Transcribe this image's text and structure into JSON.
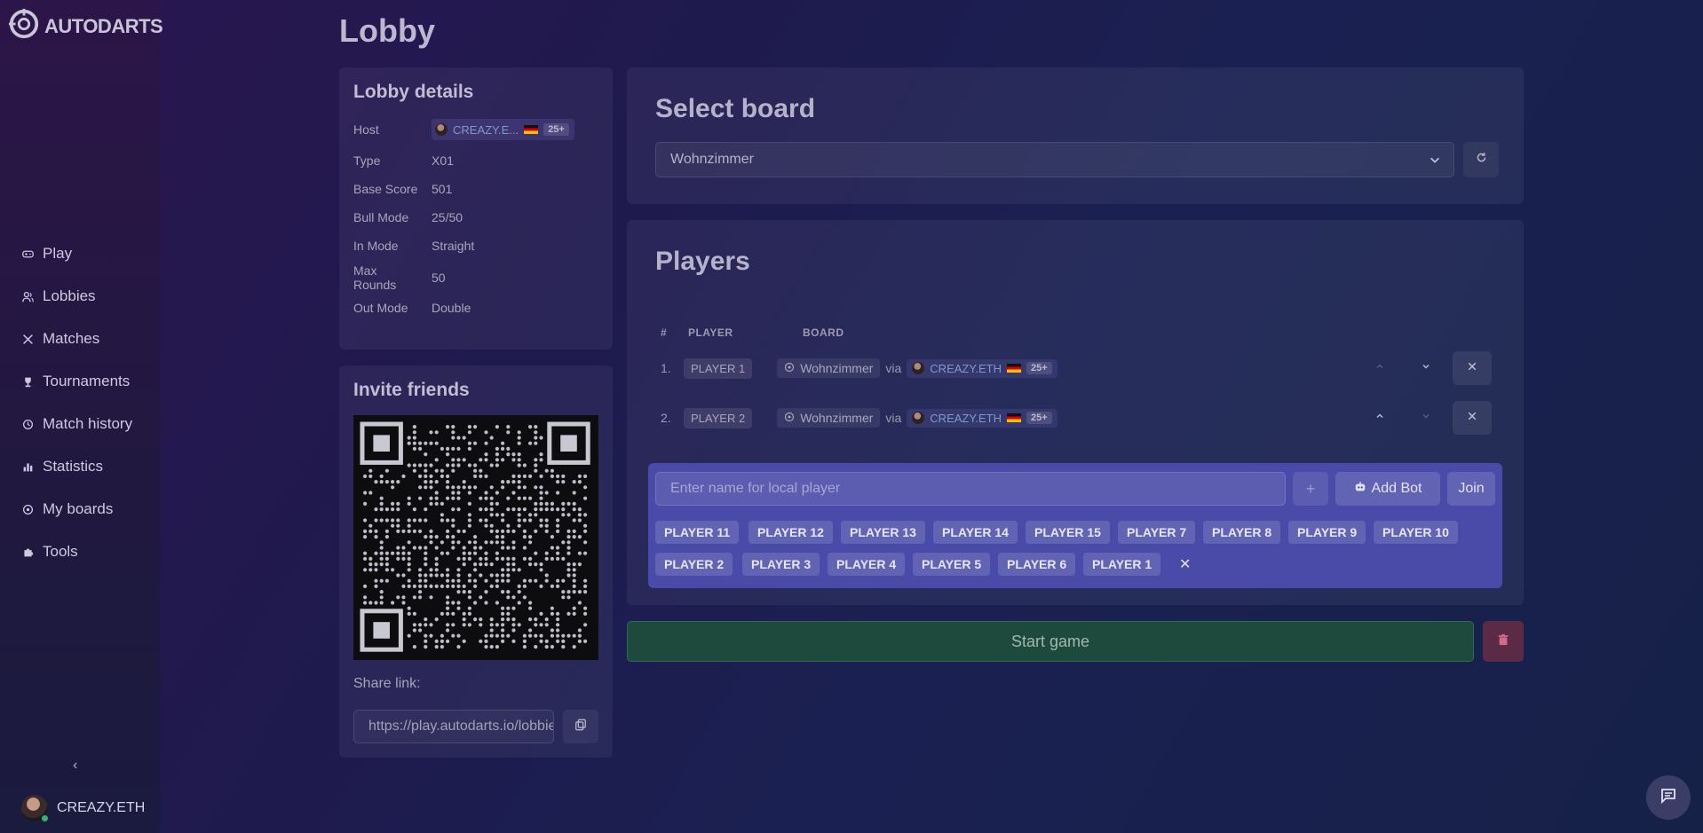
{
  "app": {
    "logo_text": "AUTODARTS"
  },
  "page": {
    "title": "Lobby"
  },
  "sidebar": {
    "items": [
      {
        "label": "Play",
        "icon": "gamepad-icon"
      },
      {
        "label": "Lobbies",
        "icon": "users-icon"
      },
      {
        "label": "Matches",
        "icon": "crossed-swords-icon"
      },
      {
        "label": "Tournaments",
        "icon": "trophy-icon"
      },
      {
        "label": "Match history",
        "icon": "history-icon"
      },
      {
        "label": "Statistics",
        "icon": "bar-chart-icon"
      },
      {
        "label": "My boards",
        "icon": "target-icon"
      },
      {
        "label": "Tools",
        "icon": "puzzle-icon"
      }
    ],
    "collapse_icon": "‹",
    "user": {
      "name": "CREAZY.ETH"
    }
  },
  "details": {
    "title": "Lobby details",
    "host_label": "Host",
    "host_name": "CREAZY.E...",
    "host_level": "25+",
    "rows": [
      {
        "k": "Type",
        "v": "X01"
      },
      {
        "k": "Base Score",
        "v": "501"
      },
      {
        "k": "Bull Mode",
        "v": "25/50"
      },
      {
        "k": "In Mode",
        "v": "Straight"
      },
      {
        "k": "Max Rounds",
        "v": "50"
      },
      {
        "k": "Out Mode",
        "v": "Double"
      }
    ]
  },
  "invite": {
    "title": "Invite friends",
    "share_label": "Share link:",
    "share_value": "https://play.autodarts.io/lobbies/"
  },
  "select_board": {
    "title": "Select board",
    "selected": "Wohnzimmer"
  },
  "players": {
    "title": "Players",
    "headers": {
      "num": "#",
      "player": "PLAYER",
      "board": "BOARD"
    },
    "via": "via",
    "rows": [
      {
        "num": "1.",
        "player": "PLAYER 1",
        "board": "Wohnzimmer",
        "owner": "CREAZY.ETH",
        "level": "25+"
      },
      {
        "num": "2.",
        "player": "PLAYER 2",
        "board": "Wohnzimmer",
        "owner": "CREAZY.ETH",
        "level": "25+"
      }
    ]
  },
  "add_player": {
    "placeholder": "Enter name for local player",
    "plus": "+",
    "add_bot_label": "Add Bot",
    "join_label": "Join",
    "suggestions_row1": [
      "PLAYER 11",
      "PLAYER 12",
      "PLAYER 13",
      "PLAYER 14",
      "PLAYER 15",
      "PLAYER 7",
      "PLAYER 8",
      "PLAYER 9",
      "PLAYER 10"
    ],
    "suggestions_row2": [
      "PLAYER 2",
      "PLAYER 3",
      "PLAYER 4",
      "PLAYER 5",
      "PLAYER 6",
      "PLAYER 1"
    ],
    "clear": "✕"
  },
  "actions": {
    "start_label": "Start game"
  },
  "colors": {
    "add_panel": "#4a4aa8",
    "start": "#1e4a3e",
    "delete": "#5a2a46"
  }
}
